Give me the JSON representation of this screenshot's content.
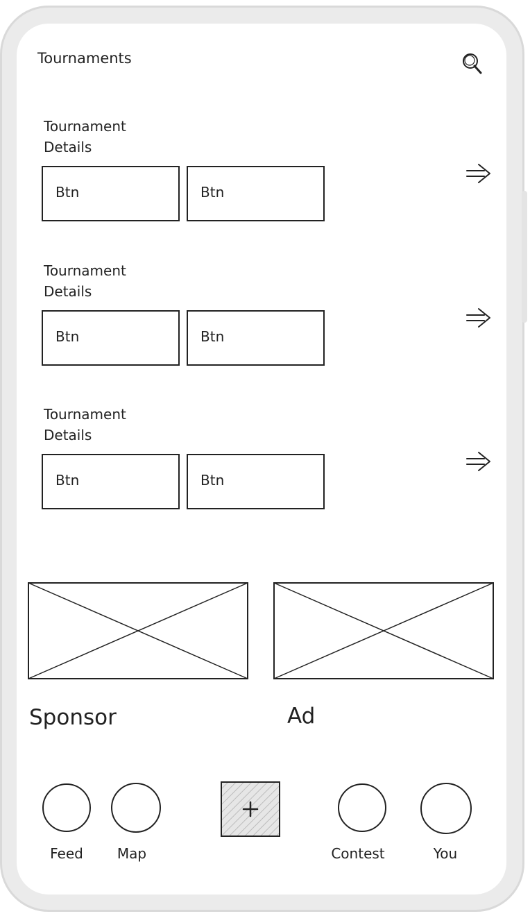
{
  "header": {
    "title": "Tournaments",
    "search_icon": "search-icon"
  },
  "tournaments": [
    {
      "details": "Tournament\nDetails",
      "btn1": "Btn",
      "btn2": "Btn"
    },
    {
      "details": "Tournament\nDetails",
      "btn1": "Btn",
      "btn2": "Btn"
    },
    {
      "details": "Tournament\nDetails",
      "btn1": "Btn",
      "btn2": "Btn"
    }
  ],
  "promo": {
    "sponsor_label": "Sponsor",
    "ad_label": "Ad"
  },
  "nav": {
    "items": [
      {
        "label": "Feed"
      },
      {
        "label": "Map"
      },
      {
        "label": "Contest"
      },
      {
        "label": "You"
      }
    ],
    "add_icon": "plus-icon"
  }
}
